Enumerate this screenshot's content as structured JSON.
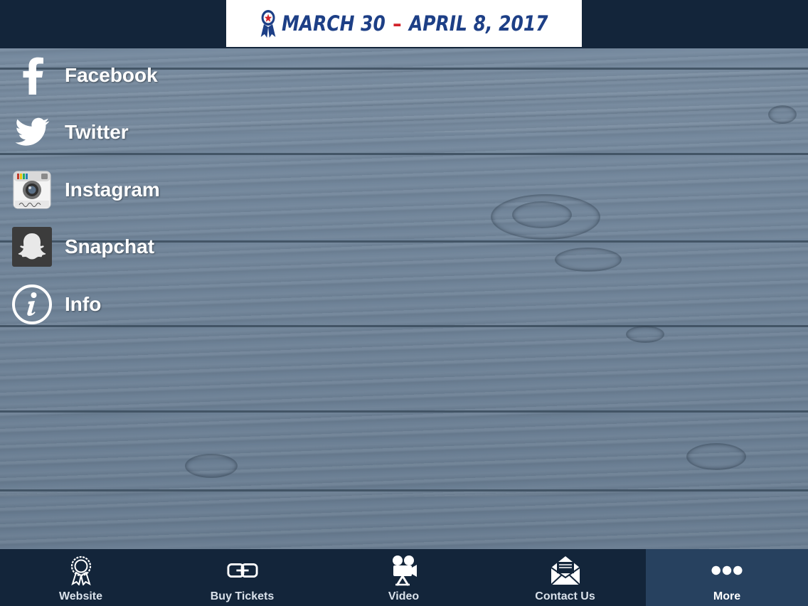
{
  "header": {
    "date_start": "MARCH 30",
    "date_separator": "–",
    "date_end": "APRIL 8, 2017",
    "colors": {
      "bar": "#13253a",
      "banner": "#ffffff",
      "text": "#1d3f86",
      "dash": "#d2232a"
    }
  },
  "menu": {
    "items": [
      {
        "label": "Facebook",
        "icon": "facebook-icon"
      },
      {
        "label": "Twitter",
        "icon": "twitter-icon"
      },
      {
        "label": "Instagram",
        "icon": "instagram-icon"
      },
      {
        "label": "Snapchat",
        "icon": "snapchat-icon"
      },
      {
        "label": "Info",
        "icon": "info-icon"
      }
    ]
  },
  "tabbar": {
    "tabs": [
      {
        "label": "Website",
        "icon": "ribbon-icon",
        "active": false
      },
      {
        "label": "Buy Tickets",
        "icon": "link-icon",
        "active": false
      },
      {
        "label": "Video",
        "icon": "video-camera-icon",
        "active": false
      },
      {
        "label": "Contact Us",
        "icon": "envelope-icon",
        "active": false
      },
      {
        "label": "More",
        "icon": "more-dots-icon",
        "active": true
      }
    ],
    "colors": {
      "bar": "#13253a",
      "active": "#27415f"
    }
  }
}
